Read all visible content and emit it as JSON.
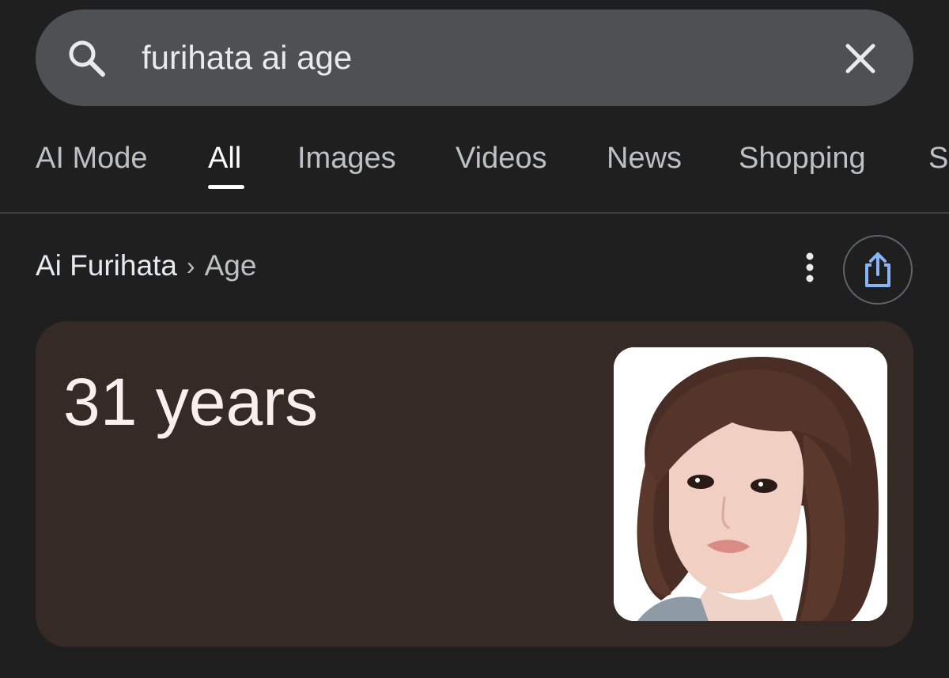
{
  "search": {
    "query": "furihata ai age",
    "search_icon": "search-icon",
    "clear_icon": "close-icon"
  },
  "tabs": [
    {
      "label": "AI Mode",
      "active": false
    },
    {
      "label": "All",
      "active": true
    },
    {
      "label": "Images",
      "active": false
    },
    {
      "label": "Videos",
      "active": false
    },
    {
      "label": "News",
      "active": false
    },
    {
      "label": "Shopping",
      "active": false
    },
    {
      "label": "S",
      "active": false
    }
  ],
  "breadcrumb": {
    "entity": "Ai Furihata",
    "separator": "›",
    "attribute": "Age"
  },
  "actions": {
    "more_icon": "more-vert-icon",
    "share_icon": "share-icon"
  },
  "answer": {
    "value": "31 years",
    "image_icon": "portrait-photo"
  },
  "colors": {
    "background": "#1f1f1f",
    "search_bar": "#4e5154",
    "card": "#352a26",
    "accent_blue": "#8ab4f8"
  }
}
